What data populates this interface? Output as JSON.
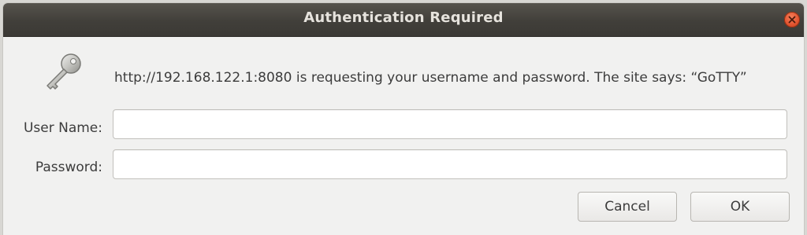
{
  "window": {
    "title": "Authentication Required"
  },
  "dialog": {
    "message": "http://192.168.122.1:8080 is requesting your username and password. The site says: “GoTTY”",
    "username_label": "User Name:",
    "username_value": "",
    "password_label": "Password:",
    "password_value": "",
    "cancel_label": "Cancel",
    "ok_label": "OK"
  },
  "icons": {
    "dialog_icon": "key-icon",
    "close": "close-icon"
  },
  "colors": {
    "titlebar": "#413f3a",
    "close_button": "#e0512d",
    "dialog_background": "#f1f1f0"
  }
}
